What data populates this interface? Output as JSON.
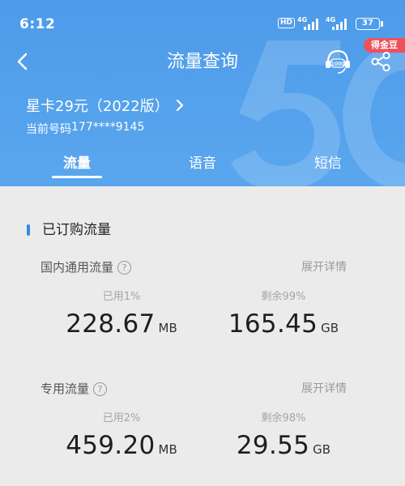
{
  "status_bar": {
    "time": "6:12",
    "hd": "HD",
    "net1": "4G",
    "net2": "4G",
    "battery": "37"
  },
  "header": {
    "title": "流量查询",
    "reward_badge": "得金豆",
    "plan_name": "星卡29元（2022版）",
    "phone_label": "当前号码",
    "phone_number": "177****9145",
    "tabs": [
      {
        "label": "流量"
      },
      {
        "label": "语音"
      },
      {
        "label": "短信"
      }
    ],
    "active_tab": "流量"
  },
  "section": {
    "title": "已订购流量"
  },
  "blocks": [
    {
      "title": "国内通用流量",
      "help": "?",
      "detail": "展开详情",
      "used_label": "已用1%",
      "used_value": "228.67",
      "used_unit": "MB",
      "remain_label": "剩余99%",
      "remain_value": "165.45",
      "remain_unit": "GB"
    },
    {
      "title": "专用流量",
      "help": "?",
      "detail": "展开详情",
      "used_label": "已用2%",
      "used_value": "459.20",
      "used_unit": "MB",
      "remain_label": "剩余98%",
      "remain_value": "29.55",
      "remain_unit": "GB"
    }
  ],
  "colors": {
    "header_blue": "#55a1ec",
    "accent": "#3b88e0",
    "badge_red": "#f0505a"
  }
}
